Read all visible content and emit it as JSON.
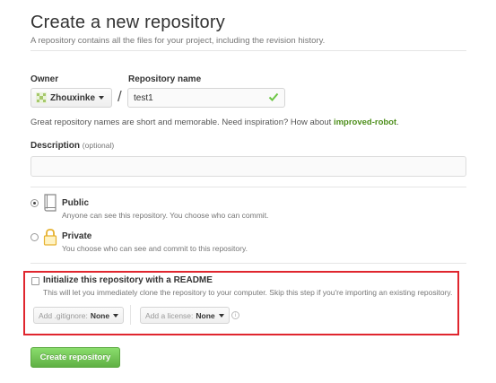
{
  "header": {
    "title": "Create a new repository",
    "subtitle": "A repository contains all the files for your project, including the revision history."
  },
  "owner": {
    "label": "Owner",
    "value": "Zhouxinke"
  },
  "repo": {
    "label": "Repository name",
    "value": "test1",
    "separator": "/"
  },
  "hint": {
    "prefix": "Great repository names are short and memorable. Need inspiration? How about ",
    "suggestion": "improved-robot",
    "suffix": "."
  },
  "description": {
    "label": "Description",
    "optional": "(optional)",
    "value": ""
  },
  "visibility": {
    "public": {
      "title": "Public",
      "desc": "Anyone can see this repository. You choose who can commit.",
      "selected": true
    },
    "private": {
      "title": "Private",
      "desc": "You choose who can see and commit to this repository.",
      "selected": false
    }
  },
  "init": {
    "title": "Initialize this repository with a README",
    "desc": "This will let you immediately clone the repository to your computer. Skip this step if you're importing an existing repository.",
    "checked": false
  },
  "gitignore": {
    "label": "Add .gitignore:",
    "value": "None"
  },
  "license": {
    "label": "Add a license:",
    "value": "None"
  },
  "info_glyph": "i",
  "submit": {
    "label": "Create repository"
  },
  "colors": {
    "accent_green": "#60b044",
    "suggestion": "#4e8f1c",
    "highlight": "#e0262e",
    "check": "#6cc644"
  }
}
